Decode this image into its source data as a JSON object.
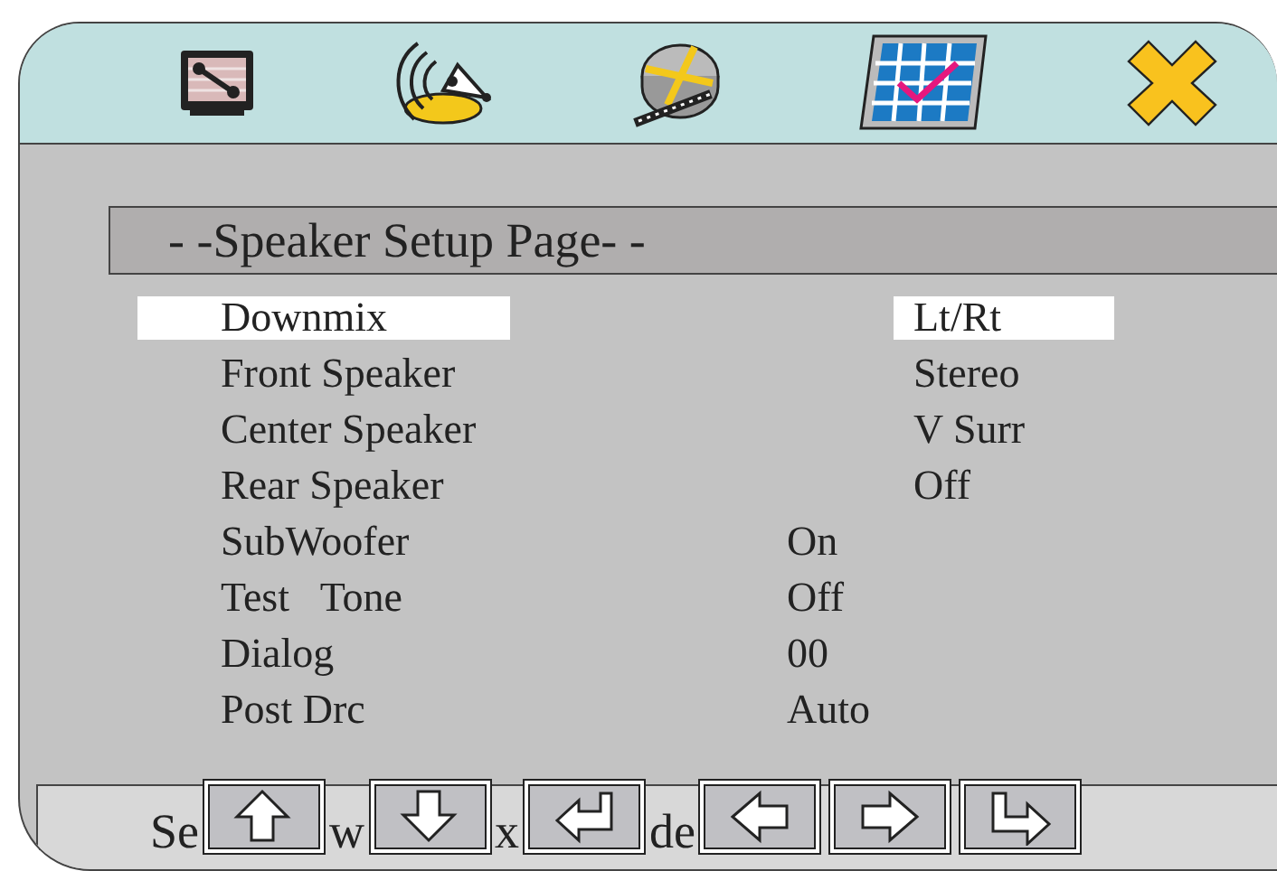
{
  "page_title": "- -Speaker Setup Page- -",
  "settings": [
    {
      "label": "Downmix",
      "value": "Lt/Rt",
      "kind": "inset",
      "selected": true
    },
    {
      "label": "Front Speaker",
      "value": "Stereo",
      "kind": "inset",
      "selected": false
    },
    {
      "label": "Center Speaker",
      "value": "V Surr",
      "kind": "inset",
      "selected": false
    },
    {
      "label": "Rear Speaker",
      "value": "Off",
      "kind": "inset",
      "selected": false
    },
    {
      "label": "SubWoofer",
      "value": "On",
      "kind": "plain",
      "selected": false
    },
    {
      "label": "Test   Tone",
      "value": "Off",
      "kind": "plain",
      "selected": false
    },
    {
      "label": "Dialog",
      "value": "00",
      "kind": "plain",
      "selected": false
    },
    {
      "label": "Post Drc",
      "value": "Auto",
      "kind": "plain",
      "selected": false
    }
  ],
  "status_bar": {
    "items": [
      {
        "kind": "text",
        "text": "Se"
      },
      {
        "kind": "button"
      },
      {
        "kind": "text",
        "text": "w"
      },
      {
        "kind": "button"
      },
      {
        "kind": "text",
        "text": "x"
      },
      {
        "kind": "button"
      },
      {
        "kind": "text",
        "text": "de"
      },
      {
        "kind": "button"
      },
      {
        "kind": "button"
      },
      {
        "kind": "button"
      }
    ]
  }
}
